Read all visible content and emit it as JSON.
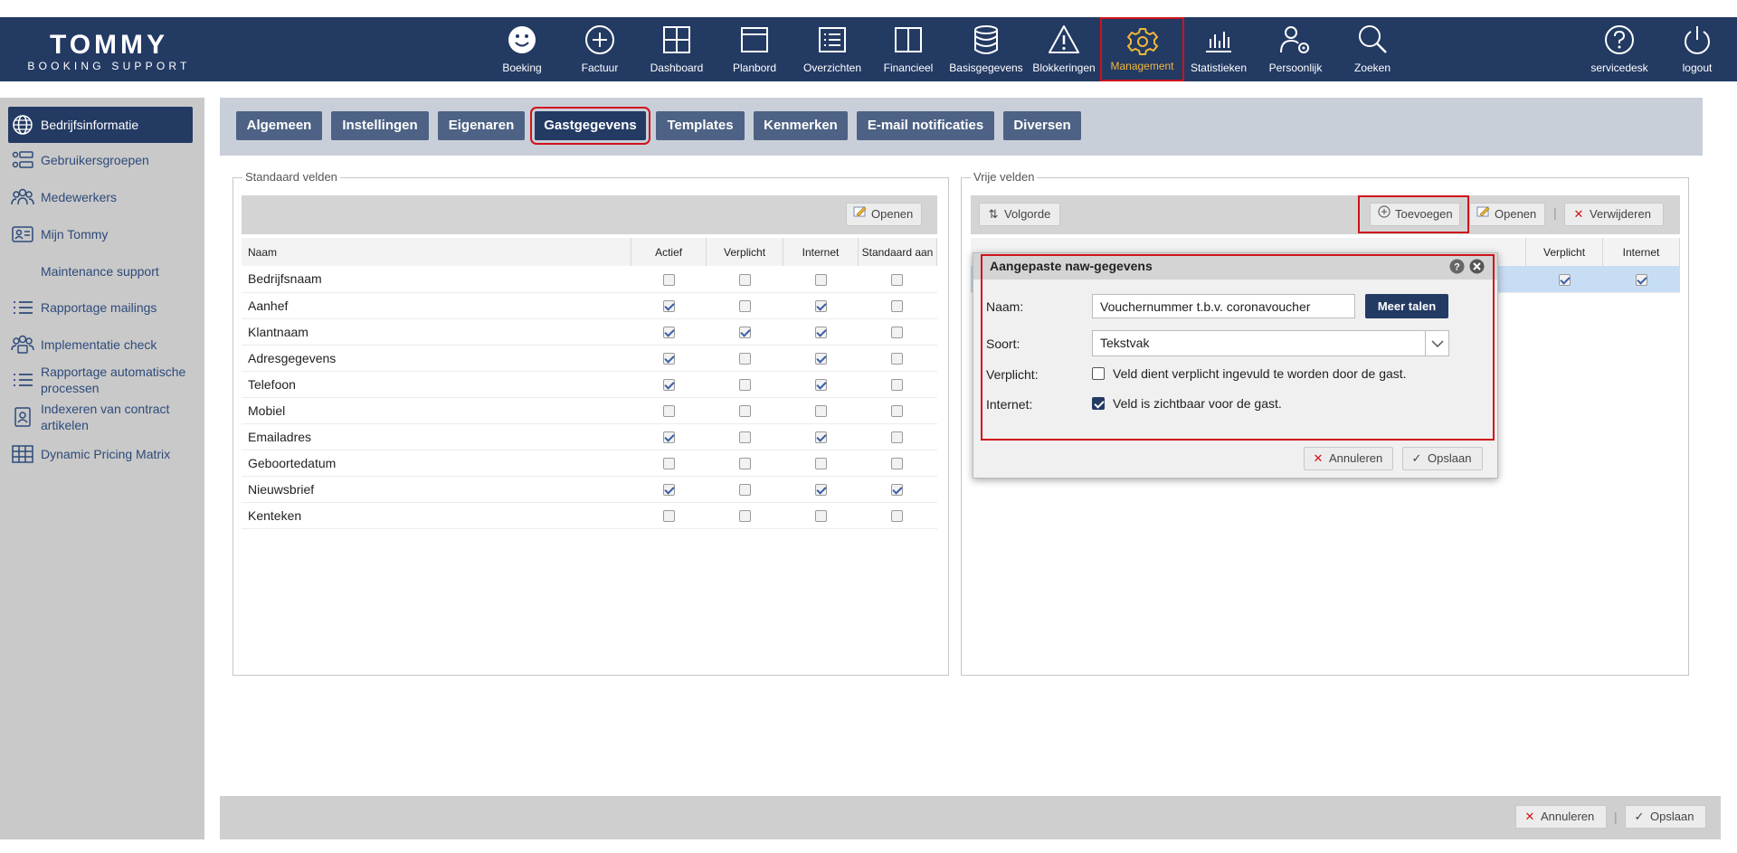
{
  "brand": {
    "name": "TOMMY",
    "tagline": "BOOKING SUPPORT"
  },
  "nav": {
    "items": [
      {
        "label": "Boeking",
        "icon": "smiley-icon"
      },
      {
        "label": "Factuur",
        "icon": "plus-circle-icon"
      },
      {
        "label": "Dashboard",
        "icon": "grid-icon"
      },
      {
        "label": "Planbord",
        "icon": "window-icon"
      },
      {
        "label": "Overzichten",
        "icon": "list-icon"
      },
      {
        "label": "Financieel",
        "icon": "book-icon"
      },
      {
        "label": "Basisgegevens",
        "icon": "database-icon"
      },
      {
        "label": "Blokkeringen",
        "icon": "warning-icon"
      },
      {
        "label": "Management",
        "icon": "gear-icon",
        "active": true
      },
      {
        "label": "Statistieken",
        "icon": "bar-chart-icon"
      },
      {
        "label": "Persoonlijk",
        "icon": "user-gear-icon"
      },
      {
        "label": "Zoeken",
        "icon": "search-icon"
      }
    ],
    "right": [
      {
        "label": "servicedesk",
        "icon": "help-icon"
      },
      {
        "label": "logout",
        "icon": "power-icon"
      }
    ],
    "active_color": "#f3b73a"
  },
  "sidebar": {
    "items": [
      {
        "label": "Bedrijfsinformatie",
        "icon": "globe-icon",
        "active": true
      },
      {
        "label": "Gebruikersgroepen",
        "icon": "user-list-icon"
      },
      {
        "label": "Medewerkers",
        "icon": "users-icon"
      },
      {
        "label": "Mijn Tommy",
        "icon": "id-card-icon"
      },
      {
        "label": "Maintenance support",
        "icon": ""
      },
      {
        "label": "Rapportage mailings",
        "icon": "list-icon"
      },
      {
        "label": "Implementatie check",
        "icon": "users-check-icon"
      },
      {
        "label": "Rapportage automatische processen",
        "icon": "list-icon"
      },
      {
        "label": "Indexeren van contract artikelen",
        "icon": "contact-icon"
      },
      {
        "label": "Dynamic Pricing Matrix",
        "icon": "table-icon"
      }
    ]
  },
  "tabs": [
    {
      "label": "Algemeen"
    },
    {
      "label": "Instellingen"
    },
    {
      "label": "Eigenaren"
    },
    {
      "label": "Gastgegevens",
      "active": true
    },
    {
      "label": "Templates"
    },
    {
      "label": "Kenmerken"
    },
    {
      "label": "E-mail notificaties"
    },
    {
      "label": "Diversen"
    }
  ],
  "standard_fields": {
    "legend": "Standaard velden",
    "open_label": "Openen",
    "columns": [
      "Naam",
      "Actief",
      "Verplicht",
      "Internet",
      "Standaard aan"
    ],
    "rows": [
      {
        "name": "Bedrijfsnaam",
        "values": [
          false,
          false,
          false,
          false
        ]
      },
      {
        "name": "Aanhef",
        "values": [
          true,
          false,
          true,
          false
        ]
      },
      {
        "name": "Klantnaam",
        "values": [
          true,
          true,
          true,
          false
        ]
      },
      {
        "name": "Adresgegevens",
        "values": [
          true,
          false,
          true,
          false
        ]
      },
      {
        "name": "Telefoon",
        "values": [
          true,
          false,
          true,
          false
        ]
      },
      {
        "name": "Mobiel",
        "values": [
          false,
          false,
          false,
          false
        ]
      },
      {
        "name": "Emailadres",
        "values": [
          true,
          false,
          true,
          false
        ]
      },
      {
        "name": "Geboortedatum",
        "values": [
          false,
          false,
          false,
          false
        ]
      },
      {
        "name": "Nieuwsbrief",
        "values": [
          true,
          false,
          true,
          true
        ]
      },
      {
        "name": "Kenteken",
        "values": [
          false,
          false,
          false,
          false
        ]
      }
    ]
  },
  "free_fields": {
    "legend": "Vrije velden",
    "order_label": "Volgorde",
    "add_label": "Toevoegen",
    "open_label": "Openen",
    "delete_label": "Verwijderen",
    "columns": [
      "Verplicht",
      "Internet"
    ],
    "row_values": [
      true,
      true
    ]
  },
  "modal": {
    "title": "Aangepaste naw-gegevens",
    "name_label": "Naam:",
    "name_value": "Vouchernummer t.b.v. coronavoucher",
    "more_languages": "Meer talen",
    "type_label": "Soort:",
    "type_value": "Tekstvak",
    "required_label": "Verplicht:",
    "required_text": "Veld dient verplicht ingevuld te worden door de gast.",
    "required_checked": false,
    "internet_label": "Internet:",
    "internet_text": "Veld is zichtbaar voor de gast.",
    "internet_checked": true,
    "cancel_label": "Annuleren",
    "save_label": "Opslaan"
  },
  "footer": {
    "cancel_label": "Annuleren",
    "save_label": "Opslaan"
  }
}
